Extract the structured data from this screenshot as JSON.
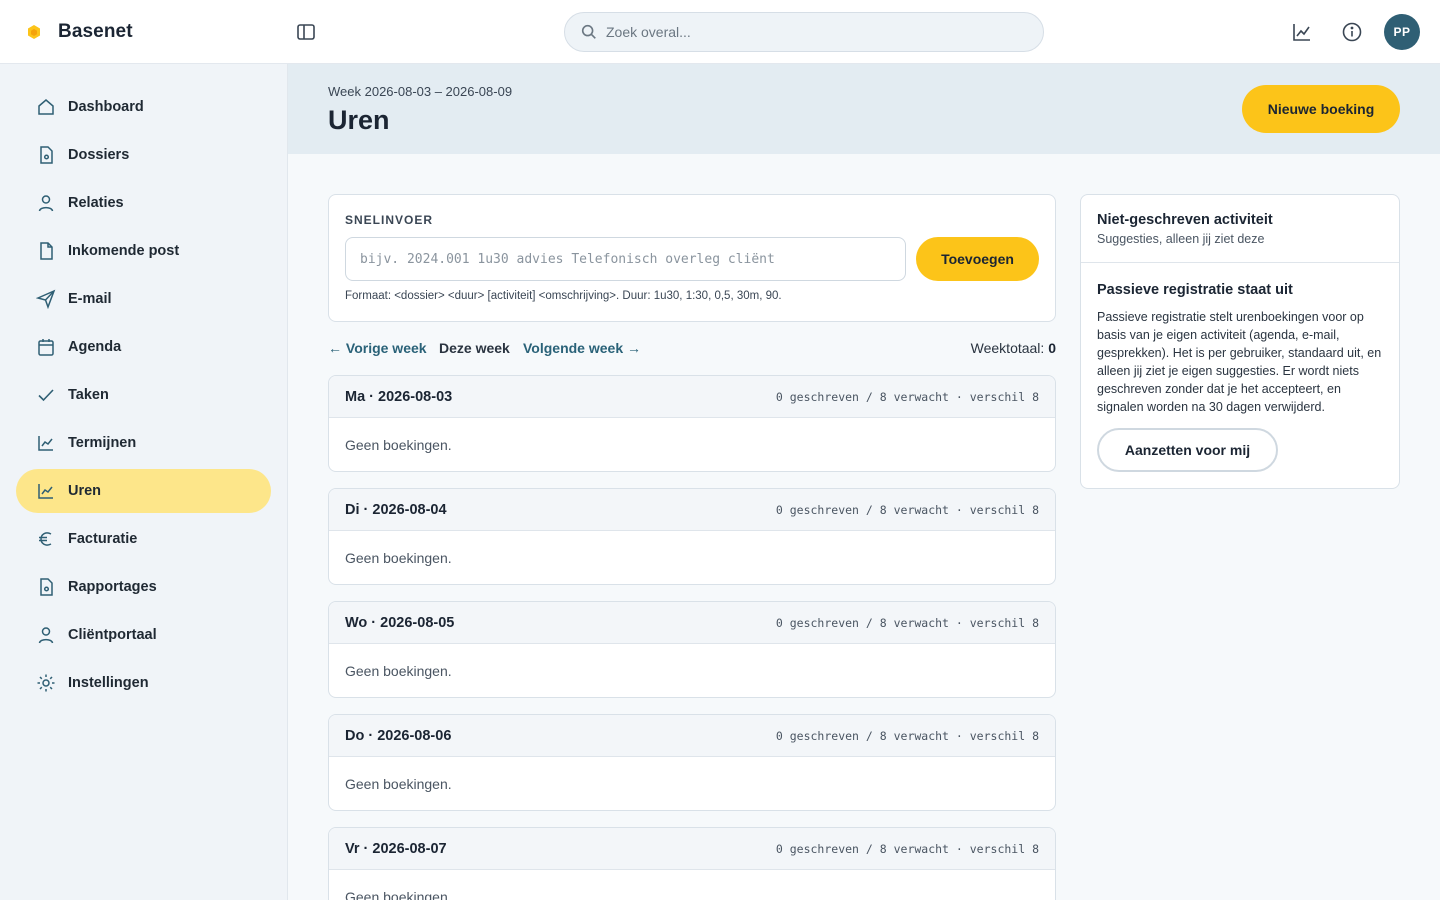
{
  "app": {
    "name": "Basenet"
  },
  "search": {
    "placeholder": "Zoek overal..."
  },
  "user": {
    "initials": "PP"
  },
  "colors": {
    "accent": "#fcc419",
    "active_nav": "#fde68a",
    "avatar": "#2f5f74",
    "link": "#2a6278"
  },
  "sidebar": {
    "items": [
      {
        "label": "Dashboard",
        "icon": "home-icon"
      },
      {
        "label": "Dossiers",
        "icon": "file-doc-icon"
      },
      {
        "label": "Relaties",
        "icon": "user-icon"
      },
      {
        "label": "Inkomende post",
        "icon": "file-icon"
      },
      {
        "label": "E-mail",
        "icon": "send-icon"
      },
      {
        "label": "Agenda",
        "icon": "calendar-icon"
      },
      {
        "label": "Taken",
        "icon": "check-icon"
      },
      {
        "label": "Termijnen",
        "icon": "chart-line-icon"
      },
      {
        "label": "Uren",
        "icon": "chart-line-icon",
        "active": true
      },
      {
        "label": "Facturatie",
        "icon": "euro-icon"
      },
      {
        "label": "Rapportages",
        "icon": "file-doc-icon"
      },
      {
        "label": "Cliëntportaal",
        "icon": "user-icon"
      },
      {
        "label": "Instellingen",
        "icon": "gear-icon"
      }
    ]
  },
  "header": {
    "week_range": "Week 2026-08-03 – 2026-08-09",
    "title": "Uren",
    "new_booking_label": "Nieuwe boeking"
  },
  "quick_entry": {
    "label": "SNELINVOER",
    "placeholder": "bijv. 2024.001 1u30 advies Telefonisch overleg cliënt",
    "add_label": "Toevoegen",
    "hint": "Formaat: <dossier> <duur> [activiteit] <omschrijving>. Duur: 1u30, 1:30, 0,5, 30m, 90."
  },
  "week_nav": {
    "prev": "← Vorige week",
    "current": "Deze week",
    "next": "Volgende week →",
    "total_label": "Weektotaal:",
    "total_value": "0"
  },
  "days": [
    {
      "title": "Ma · 2026-08-03",
      "stats": "0 geschreven / 8 verwacht · verschil 8",
      "empty": "Geen boekingen."
    },
    {
      "title": "Di · 2026-08-04",
      "stats": "0 geschreven / 8 verwacht · verschil 8",
      "empty": "Geen boekingen."
    },
    {
      "title": "Wo · 2026-08-05",
      "stats": "0 geschreven / 8 verwacht · verschil 8",
      "empty": "Geen boekingen."
    },
    {
      "title": "Do · 2026-08-06",
      "stats": "0 geschreven / 8 verwacht · verschil 8",
      "empty": "Geen boekingen."
    },
    {
      "title": "Vr · 2026-08-07",
      "stats": "0 geschreven / 8 verwacht · verschil 8",
      "empty": "Geen boekingen."
    }
  ],
  "side_panel": {
    "title": "Niet-geschreven activiteit",
    "subtitle": "Suggesties, alleen jij ziet deze",
    "heading": "Passieve registratie staat uit",
    "body": "Passieve registratie stelt urenboekingen voor op basis van je eigen activiteit (agenda, e-mail, gesprekken). Het is per gebruiker, standaard uit, en alleen jij ziet je eigen suggesties. Er wordt niets geschreven zonder dat je het accepteert, en signalen worden na 30 dagen verwijderd.",
    "button_label": "Aanzetten voor mij"
  }
}
